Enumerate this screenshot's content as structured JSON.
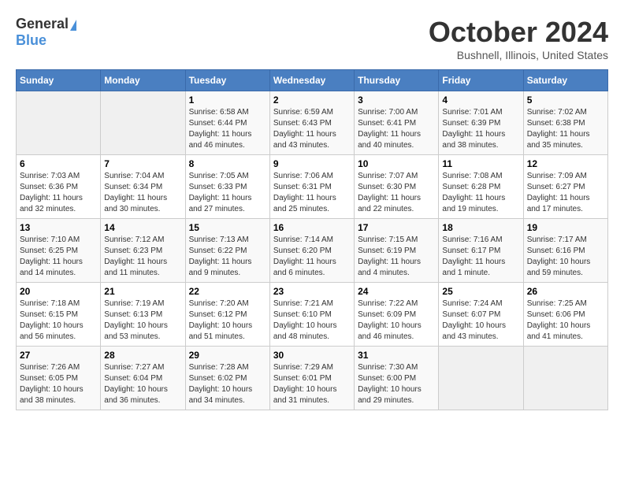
{
  "header": {
    "logo_general": "General",
    "logo_blue": "Blue",
    "title": "October 2024",
    "location": "Bushnell, Illinois, United States"
  },
  "weekdays": [
    "Sunday",
    "Monday",
    "Tuesday",
    "Wednesday",
    "Thursday",
    "Friday",
    "Saturday"
  ],
  "weeks": [
    [
      {
        "day": "",
        "sunrise": "",
        "sunset": "",
        "daylight": ""
      },
      {
        "day": "",
        "sunrise": "",
        "sunset": "",
        "daylight": ""
      },
      {
        "day": "1",
        "sunrise": "Sunrise: 6:58 AM",
        "sunset": "Sunset: 6:44 PM",
        "daylight": "Daylight: 11 hours and 46 minutes."
      },
      {
        "day": "2",
        "sunrise": "Sunrise: 6:59 AM",
        "sunset": "Sunset: 6:43 PM",
        "daylight": "Daylight: 11 hours and 43 minutes."
      },
      {
        "day": "3",
        "sunrise": "Sunrise: 7:00 AM",
        "sunset": "Sunset: 6:41 PM",
        "daylight": "Daylight: 11 hours and 40 minutes."
      },
      {
        "day": "4",
        "sunrise": "Sunrise: 7:01 AM",
        "sunset": "Sunset: 6:39 PM",
        "daylight": "Daylight: 11 hours and 38 minutes."
      },
      {
        "day": "5",
        "sunrise": "Sunrise: 7:02 AM",
        "sunset": "Sunset: 6:38 PM",
        "daylight": "Daylight: 11 hours and 35 minutes."
      }
    ],
    [
      {
        "day": "6",
        "sunrise": "Sunrise: 7:03 AM",
        "sunset": "Sunset: 6:36 PM",
        "daylight": "Daylight: 11 hours and 32 minutes."
      },
      {
        "day": "7",
        "sunrise": "Sunrise: 7:04 AM",
        "sunset": "Sunset: 6:34 PM",
        "daylight": "Daylight: 11 hours and 30 minutes."
      },
      {
        "day": "8",
        "sunrise": "Sunrise: 7:05 AM",
        "sunset": "Sunset: 6:33 PM",
        "daylight": "Daylight: 11 hours and 27 minutes."
      },
      {
        "day": "9",
        "sunrise": "Sunrise: 7:06 AM",
        "sunset": "Sunset: 6:31 PM",
        "daylight": "Daylight: 11 hours and 25 minutes."
      },
      {
        "day": "10",
        "sunrise": "Sunrise: 7:07 AM",
        "sunset": "Sunset: 6:30 PM",
        "daylight": "Daylight: 11 hours and 22 minutes."
      },
      {
        "day": "11",
        "sunrise": "Sunrise: 7:08 AM",
        "sunset": "Sunset: 6:28 PM",
        "daylight": "Daylight: 11 hours and 19 minutes."
      },
      {
        "day": "12",
        "sunrise": "Sunrise: 7:09 AM",
        "sunset": "Sunset: 6:27 PM",
        "daylight": "Daylight: 11 hours and 17 minutes."
      }
    ],
    [
      {
        "day": "13",
        "sunrise": "Sunrise: 7:10 AM",
        "sunset": "Sunset: 6:25 PM",
        "daylight": "Daylight: 11 hours and 14 minutes."
      },
      {
        "day": "14",
        "sunrise": "Sunrise: 7:12 AM",
        "sunset": "Sunset: 6:23 PM",
        "daylight": "Daylight: 11 hours and 11 minutes."
      },
      {
        "day": "15",
        "sunrise": "Sunrise: 7:13 AM",
        "sunset": "Sunset: 6:22 PM",
        "daylight": "Daylight: 11 hours and 9 minutes."
      },
      {
        "day": "16",
        "sunrise": "Sunrise: 7:14 AM",
        "sunset": "Sunset: 6:20 PM",
        "daylight": "Daylight: 11 hours and 6 minutes."
      },
      {
        "day": "17",
        "sunrise": "Sunrise: 7:15 AM",
        "sunset": "Sunset: 6:19 PM",
        "daylight": "Daylight: 11 hours and 4 minutes."
      },
      {
        "day": "18",
        "sunrise": "Sunrise: 7:16 AM",
        "sunset": "Sunset: 6:17 PM",
        "daylight": "Daylight: 11 hours and 1 minute."
      },
      {
        "day": "19",
        "sunrise": "Sunrise: 7:17 AM",
        "sunset": "Sunset: 6:16 PM",
        "daylight": "Daylight: 10 hours and 59 minutes."
      }
    ],
    [
      {
        "day": "20",
        "sunrise": "Sunrise: 7:18 AM",
        "sunset": "Sunset: 6:15 PM",
        "daylight": "Daylight: 10 hours and 56 minutes."
      },
      {
        "day": "21",
        "sunrise": "Sunrise: 7:19 AM",
        "sunset": "Sunset: 6:13 PM",
        "daylight": "Daylight: 10 hours and 53 minutes."
      },
      {
        "day": "22",
        "sunrise": "Sunrise: 7:20 AM",
        "sunset": "Sunset: 6:12 PM",
        "daylight": "Daylight: 10 hours and 51 minutes."
      },
      {
        "day": "23",
        "sunrise": "Sunrise: 7:21 AM",
        "sunset": "Sunset: 6:10 PM",
        "daylight": "Daylight: 10 hours and 48 minutes."
      },
      {
        "day": "24",
        "sunrise": "Sunrise: 7:22 AM",
        "sunset": "Sunset: 6:09 PM",
        "daylight": "Daylight: 10 hours and 46 minutes."
      },
      {
        "day": "25",
        "sunrise": "Sunrise: 7:24 AM",
        "sunset": "Sunset: 6:07 PM",
        "daylight": "Daylight: 10 hours and 43 minutes."
      },
      {
        "day": "26",
        "sunrise": "Sunrise: 7:25 AM",
        "sunset": "Sunset: 6:06 PM",
        "daylight": "Daylight: 10 hours and 41 minutes."
      }
    ],
    [
      {
        "day": "27",
        "sunrise": "Sunrise: 7:26 AM",
        "sunset": "Sunset: 6:05 PM",
        "daylight": "Daylight: 10 hours and 38 minutes."
      },
      {
        "day": "28",
        "sunrise": "Sunrise: 7:27 AM",
        "sunset": "Sunset: 6:04 PM",
        "daylight": "Daylight: 10 hours and 36 minutes."
      },
      {
        "day": "29",
        "sunrise": "Sunrise: 7:28 AM",
        "sunset": "Sunset: 6:02 PM",
        "daylight": "Daylight: 10 hours and 34 minutes."
      },
      {
        "day": "30",
        "sunrise": "Sunrise: 7:29 AM",
        "sunset": "Sunset: 6:01 PM",
        "daylight": "Daylight: 10 hours and 31 minutes."
      },
      {
        "day": "31",
        "sunrise": "Sunrise: 7:30 AM",
        "sunset": "Sunset: 6:00 PM",
        "daylight": "Daylight: 10 hours and 29 minutes."
      },
      {
        "day": "",
        "sunrise": "",
        "sunset": "",
        "daylight": ""
      },
      {
        "day": "",
        "sunrise": "",
        "sunset": "",
        "daylight": ""
      }
    ]
  ]
}
